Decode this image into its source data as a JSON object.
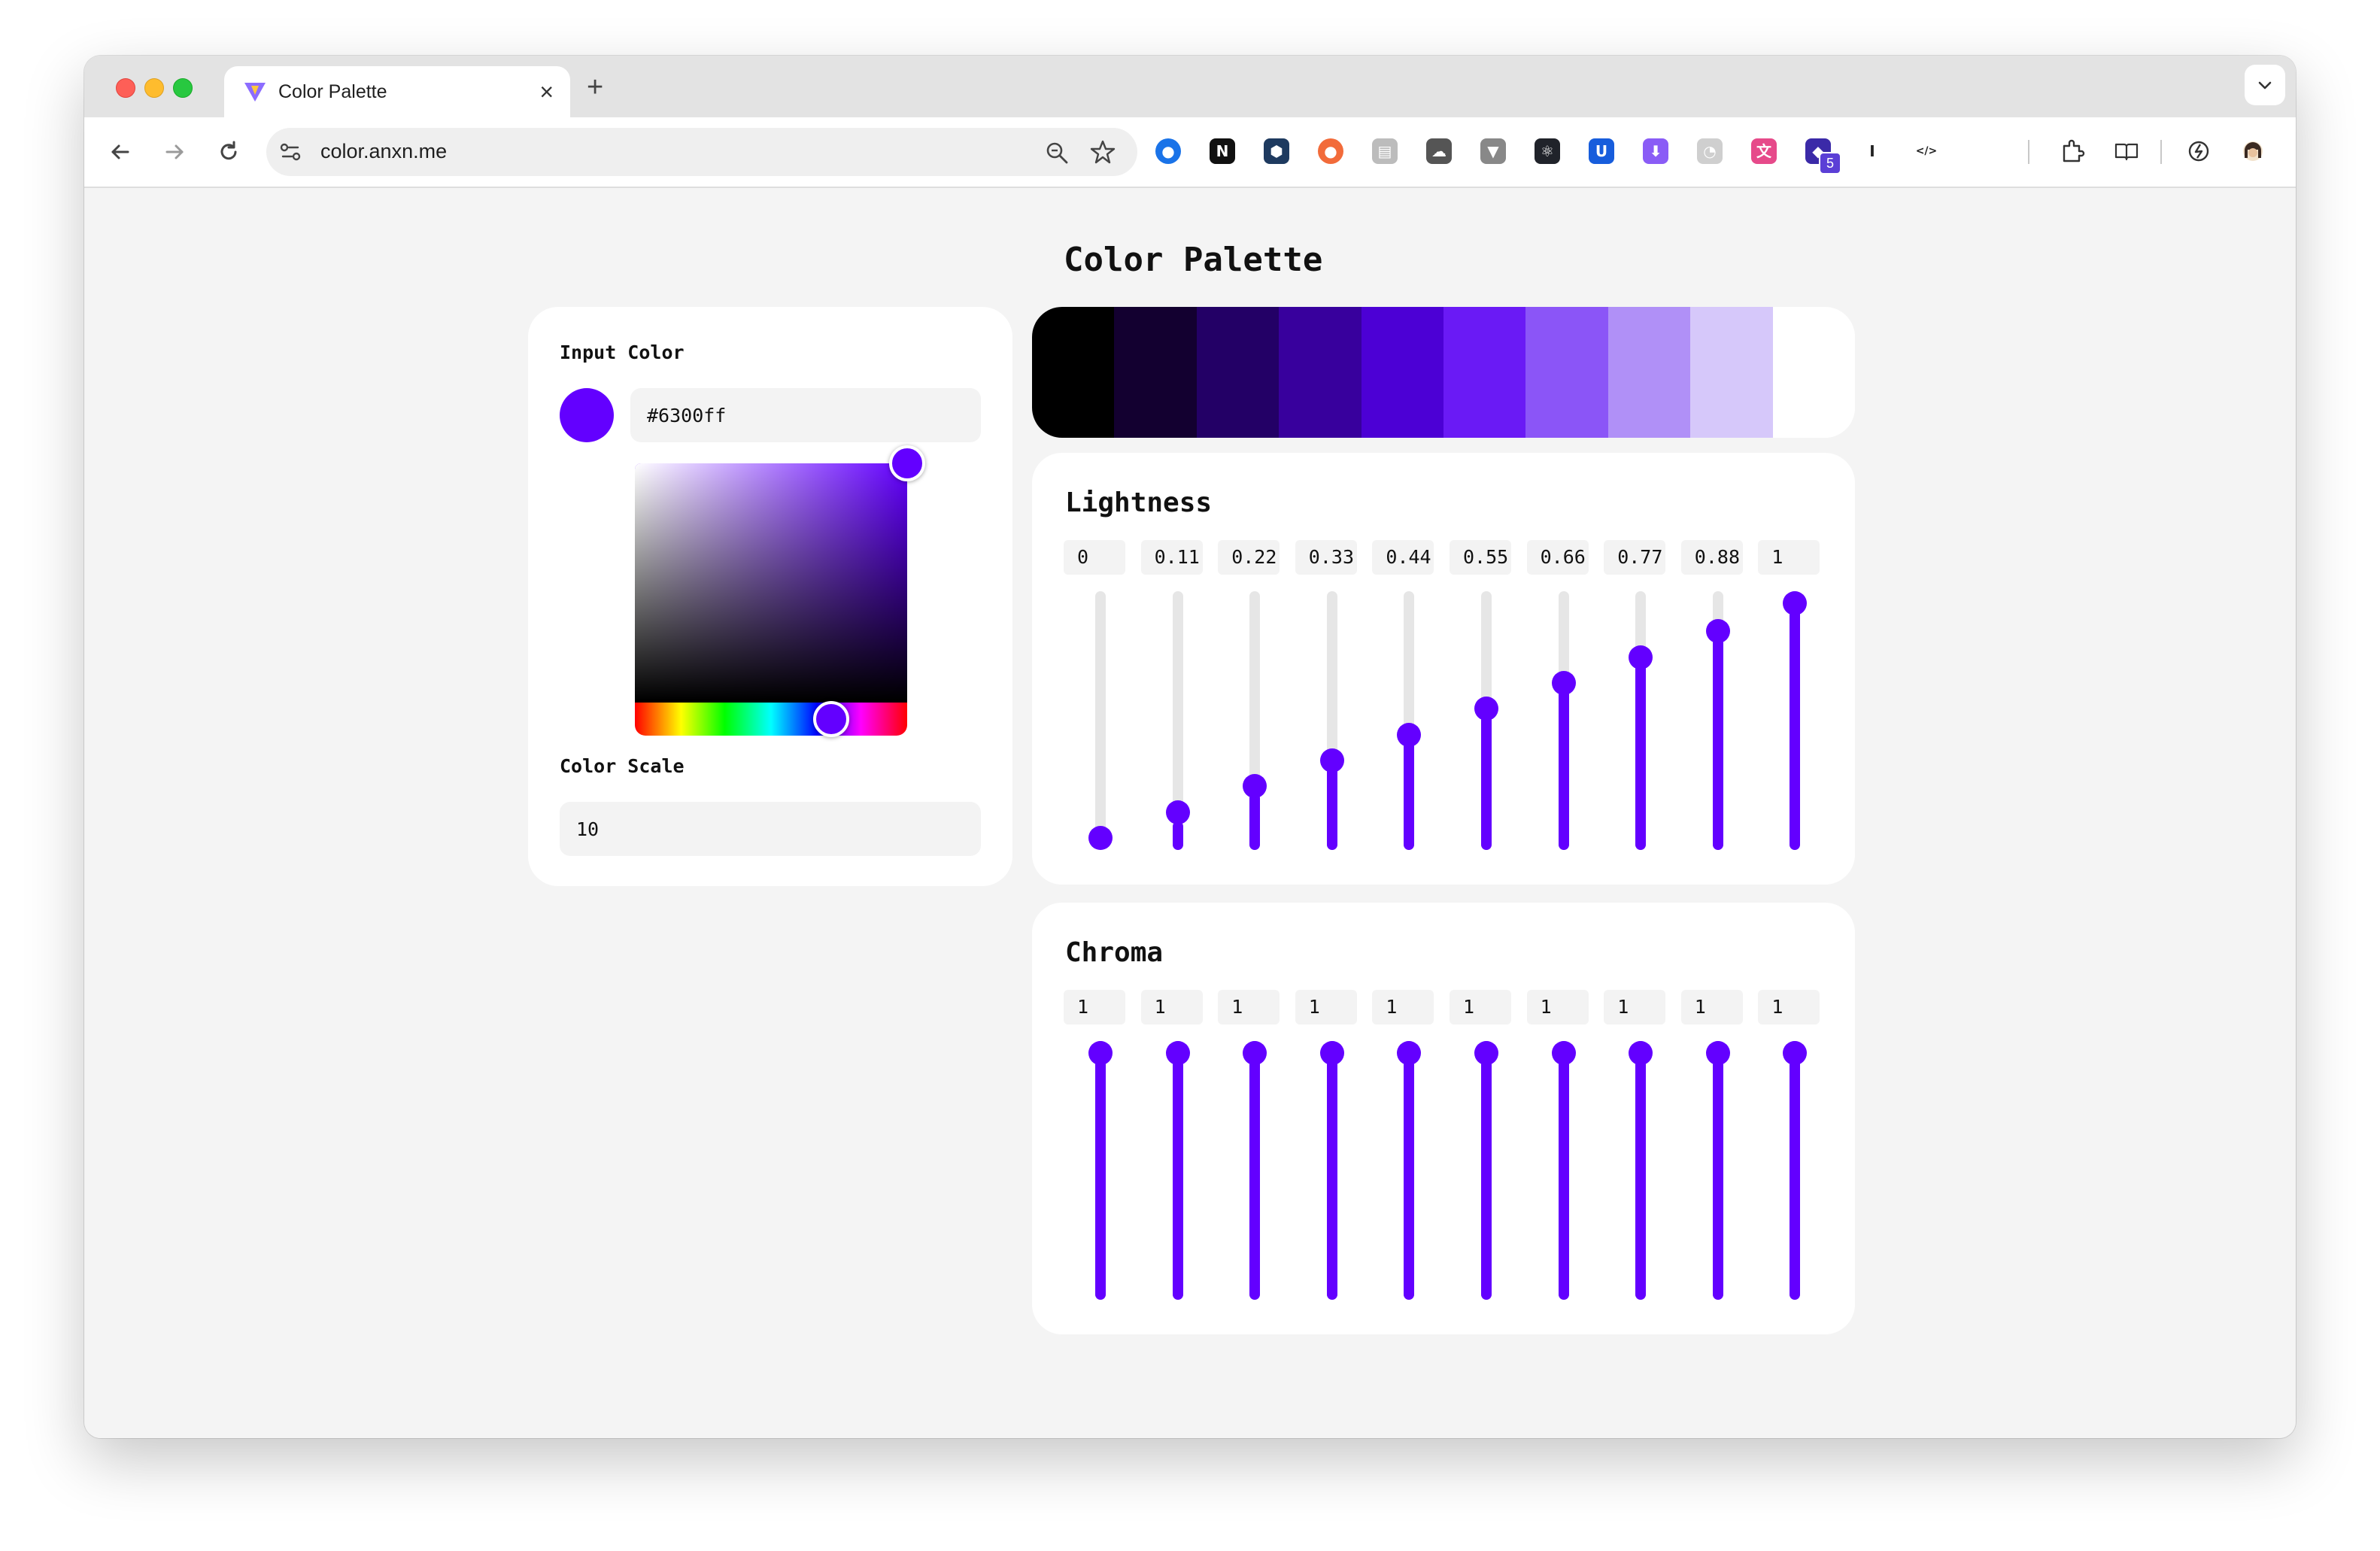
{
  "browser": {
    "tab_title": "Color Palette",
    "tab_close": "×",
    "new_tab": "+",
    "url": "color.anxn.me",
    "extension_badge": "5",
    "extensions": [
      {
        "name": "chrome-extension-1-icon",
        "color": "#1a73e8",
        "glyph": "●"
      },
      {
        "name": "notion-icon",
        "color": "#111111",
        "glyph": "N"
      },
      {
        "name": "shield-extension-icon",
        "color": "#1e3a5f",
        "glyph": "⬢"
      },
      {
        "name": "orange-extension-icon",
        "color": "#f26b3a",
        "glyph": "●"
      },
      {
        "name": "document-icon",
        "color": "#bcbcbc",
        "glyph": "▤"
      },
      {
        "name": "cloud-icon",
        "color": "#555555",
        "glyph": "☁"
      },
      {
        "name": "vue-devtools-icon",
        "color": "#888888",
        "glyph": "▼"
      },
      {
        "name": "react-devtools-icon",
        "color": "#20232a",
        "glyph": "⚛"
      },
      {
        "name": "bitwarden-icon",
        "color": "#175ddc",
        "glyph": "U"
      },
      {
        "name": "purple-extension-icon",
        "color": "#8a5cf6",
        "glyph": "⬇"
      },
      {
        "name": "timer-icon",
        "color": "#cfcfcf",
        "glyph": "◔"
      },
      {
        "name": "translate-icon",
        "color": "#e64a8a",
        "glyph": "文"
      },
      {
        "name": "badge-extension-icon",
        "color": "#3b2aa8",
        "glyph": "◆"
      },
      {
        "name": "instapaper-icon",
        "color": "#ffffff",
        "glyph": "I"
      },
      {
        "name": "code-extension-icon",
        "color": "#ffffff",
        "glyph": "</>"
      }
    ]
  },
  "page": {
    "title": "Color Palette"
  },
  "input_card": {
    "input_color_label": "Input Color",
    "hex_value": "#6300ff",
    "color_scale_label": "Color Scale",
    "color_scale_value": "10",
    "hue_fraction": 0.72,
    "saturation": 1,
    "brightness": 1
  },
  "palette": {
    "swatches": [
      "#000000",
      "#130030",
      "#230066",
      "#38009d",
      "#4c00d5",
      "#6a1af5",
      "#8b55f7",
      "#b090f7",
      "#d6c8fa",
      "#ffffff"
    ]
  },
  "lightness": {
    "heading": "Lightness",
    "values": [
      "0",
      "0.11",
      "0.22",
      "0.33",
      "0.44",
      "0.55",
      "0.66",
      "0.77",
      "0.88",
      "1"
    ],
    "levels": [
      0,
      0.11,
      0.22,
      0.33,
      0.44,
      0.55,
      0.66,
      0.77,
      0.88,
      1
    ]
  },
  "chroma": {
    "heading": "Chroma",
    "values": [
      "1",
      "1",
      "1",
      "1",
      "1",
      "1",
      "1",
      "1",
      "1",
      "1"
    ],
    "levels": [
      1,
      1,
      1,
      1,
      1,
      1,
      1,
      1,
      1,
      1
    ]
  },
  "colors": {
    "accent": "#6300ff",
    "track": "#e6e6e6",
    "background": "#f4f4f4"
  }
}
